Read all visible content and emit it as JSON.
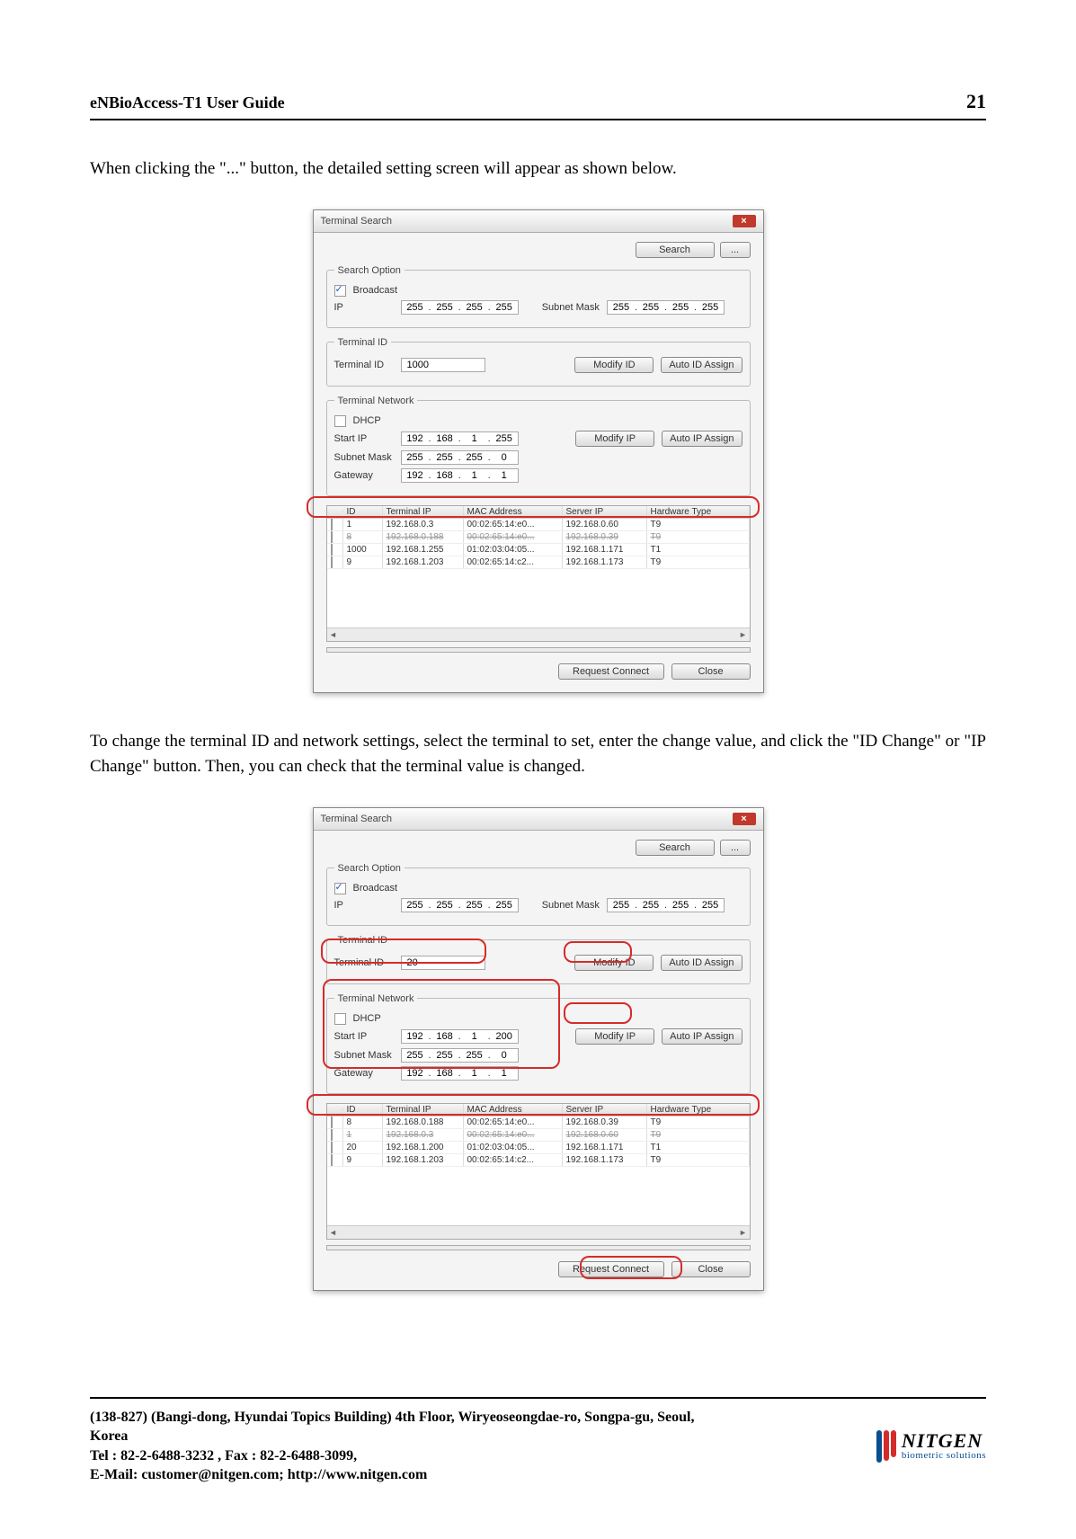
{
  "header": {
    "title": "eNBioAccess-T1 User Guide",
    "page": "21"
  },
  "para1": "When clicking the \"...\" button, the detailed setting screen will appear as shown below.",
  "para2": "To change the terminal ID and network settings, select the terminal to set, enter the change value, and click the \"ID Change\" or \"IP Change\" button. Then, you can check that the terminal value is changed.",
  "dialog_common": {
    "title": "Terminal Search",
    "search_btn": "Search",
    "more_btn": "...",
    "group_search": "Search Option",
    "broadcast_lbl": "Broadcast",
    "ip_lbl": "IP",
    "subnet_mask_lbl": "Subnet Mask",
    "group_tid": "Terminal ID",
    "tid_lbl": "Terminal ID",
    "modify_id_btn": "Modify ID",
    "auto_id_btn": "Auto ID Assign",
    "group_net": "Terminal Network",
    "dhcp_lbl": "DHCP",
    "start_ip_lbl": "Start IP",
    "subnet2_lbl": "Subnet Mask",
    "gateway_lbl": "Gateway",
    "modify_ip_btn": "Modify IP",
    "auto_ip_btn": "Auto IP Assign",
    "cols": [
      "",
      "ID",
      "Terminal IP",
      "MAC Address",
      "Server IP",
      "Hardware Type"
    ],
    "req_connect_btn": "Request Connect",
    "close_btn": "Close"
  },
  "dialog1": {
    "broadcast_ip": [
      "255",
      "255",
      "255",
      "255"
    ],
    "broadcast_mask": [
      "255",
      "255",
      "255",
      "255"
    ],
    "tid_value": "1000",
    "start_ip": [
      "192",
      "168",
      "1",
      "255"
    ],
    "subnet": [
      "255",
      "255",
      "255",
      "0"
    ],
    "gateway": [
      "192",
      "168",
      "1",
      "1"
    ],
    "rows": [
      {
        "id": "1",
        "tip": "192.168.0.3",
        "mac": "00:02:65:14:e0...",
        "sip": "192.168.0.60",
        "hw": "T9"
      },
      {
        "id": "8",
        "tip": "192.168.0.188",
        "mac": "00:02:65:14:e0...",
        "sip": "192.168.0.39",
        "hw": "T9"
      },
      {
        "id": "1000",
        "tip": "192.168.1.255",
        "mac": "01:02:03:04:05...",
        "sip": "192.168.1.171",
        "hw": "T1"
      },
      {
        "id": "9",
        "tip": "192.168.1.203",
        "mac": "00:02:65:14:c2...",
        "sip": "192.168.1.173",
        "hw": "T9"
      }
    ]
  },
  "dialog2": {
    "broadcast_ip": [
      "255",
      "255",
      "255",
      "255"
    ],
    "broadcast_mask": [
      "255",
      "255",
      "255",
      "255"
    ],
    "tid_value": "20",
    "start_ip": [
      "192",
      "168",
      "1",
      "200"
    ],
    "subnet": [
      "255",
      "255",
      "255",
      "0"
    ],
    "gateway": [
      "192",
      "168",
      "1",
      "1"
    ],
    "rows": [
      {
        "id": "8",
        "tip": "192.168.0.188",
        "mac": "00:02:65:14:e0...",
        "sip": "192.168.0.39",
        "hw": "T9"
      },
      {
        "id": "1",
        "tip": "192.168.0.3",
        "mac": "00:02:65:14:e0...",
        "sip": "192.168.0.60",
        "hw": "T9"
      },
      {
        "id": "20",
        "tip": "192.168.1.200",
        "mac": "01:02:03:04:05...",
        "sip": "192.168.1.171",
        "hw": "T1"
      },
      {
        "id": "9",
        "tip": "192.168.1.203",
        "mac": "00:02:65:14:c2...",
        "sip": "192.168.1.173",
        "hw": "T9"
      }
    ]
  },
  "footer": {
    "addr": "(138-827) (Bangi-dong, Hyundai Topics Building) 4th Floor, Wiryeoseongdae-ro, Songpa-gu, Seoul, Korea",
    "tel": "Tel : 82-2-6488-3232 , Fax : 82-2-6488-3099,",
    "email": "E-Mail: customer@nitgen.com;   http://www.nitgen.com",
    "logo_name": "NITGEN",
    "logo_sub": "biometric solutions"
  }
}
